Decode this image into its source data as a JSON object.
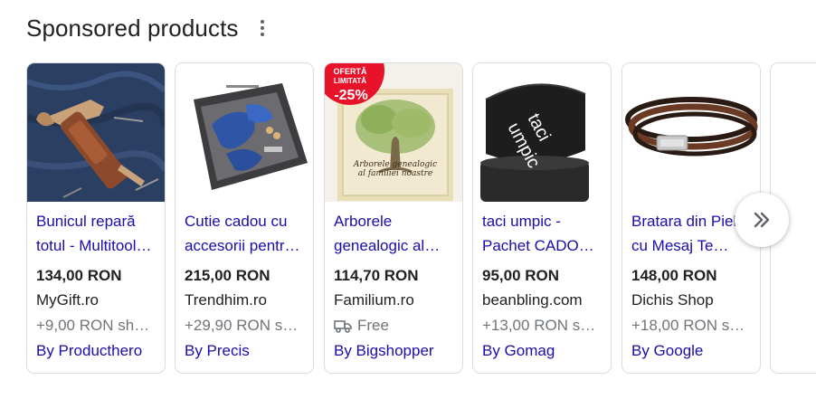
{
  "header": {
    "title": "Sponsored products",
    "more_icon": "more-vert-icon"
  },
  "products": [
    {
      "name_line1": "Bunicul repară",
      "name_line2": "totul - Multitool…",
      "price": "134,00 RON",
      "store": "MyGift.ro",
      "shipping": "+9,00 RON sh…",
      "by": "By Producthero"
    },
    {
      "name_line1": "Cutie cadou cu",
      "name_line2": "accesorii pentr…",
      "price": "215,00 RON",
      "store": "Trendhim.ro",
      "shipping": "+29,90 RON s…",
      "by": "By Precis"
    },
    {
      "name_line1": "Arborele",
      "name_line2": "genealogic al…",
      "price": "114,70 RON",
      "store": "Familium.ro",
      "shipping": "Free",
      "by": "By Bigshopper",
      "badge": {
        "line1": "OFERTĂ",
        "line2": "LIMITATĂ",
        "discount": "-25%"
      },
      "book_title_line1": "Arborele genealogic",
      "book_title_line2": "al familiei noastre"
    },
    {
      "name_line1": "taci umpic -",
      "name_line2": "Pachet CADO…",
      "price": "95,00 RON",
      "store": "beanbling.com",
      "shipping": "+13,00 RON s…",
      "by": "By Gomag",
      "box_text_line1": "taci",
      "box_text_line2": "umpic"
    },
    {
      "name_line1": "Bratara din Piele",
      "name_line2": "cu Mesaj Te…",
      "price": "148,00 RON",
      "store": "Dichis Shop",
      "shipping": "+18,00 RON s…",
      "by": "By Google"
    }
  ],
  "carousel": {
    "next_icon": "double-chevron-right-icon"
  },
  "colors": {
    "link": "#1a0dab",
    "muted": "#70757a",
    "badge": "#e8132b",
    "border": "#dadce0"
  }
}
